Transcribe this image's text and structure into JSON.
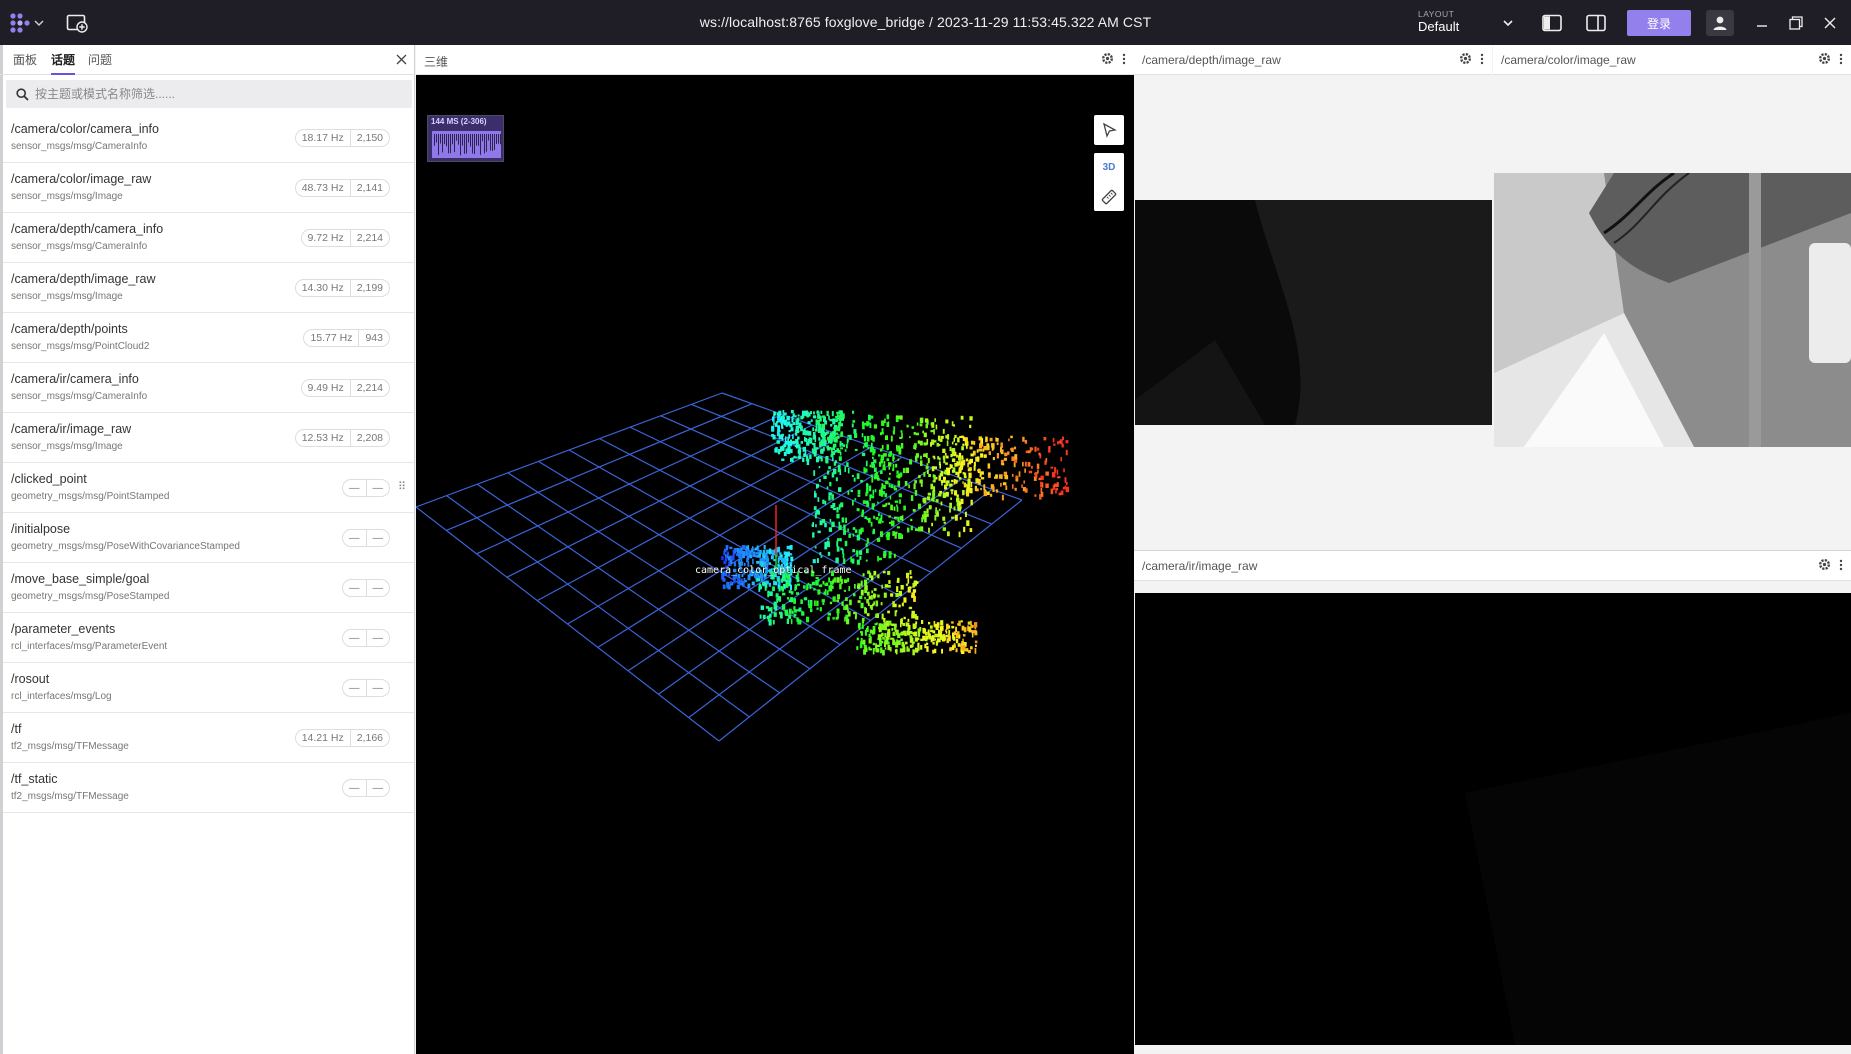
{
  "titlebar": {
    "title": "ws://localhost:8765 foxglove_bridge / 2023-11-29 11:53:45.322 AM CST",
    "layout_label": "LAYOUT",
    "layout_value": "Default",
    "login_label": "登录"
  },
  "sidebar": {
    "tabs": [
      {
        "label": "面板",
        "active": false
      },
      {
        "label": "话题",
        "active": true
      },
      {
        "label": "问题",
        "active": false
      }
    ],
    "search_placeholder": "按主题或模式名称筛选......",
    "topics": [
      {
        "name": "/camera/color/camera_info",
        "type": "sensor_msgs/msg/CameraInfo",
        "hz": "18.17 Hz",
        "count": "2,150"
      },
      {
        "name": "/camera/color/image_raw",
        "type": "sensor_msgs/msg/Image",
        "hz": "48.73 Hz",
        "count": "2,141"
      },
      {
        "name": "/camera/depth/camera_info",
        "type": "sensor_msgs/msg/CameraInfo",
        "hz": "9.72 Hz",
        "count": "2,214"
      },
      {
        "name": "/camera/depth/image_raw",
        "type": "sensor_msgs/msg/Image",
        "hz": "14.30 Hz",
        "count": "2,199"
      },
      {
        "name": "/camera/depth/points",
        "type": "sensor_msgs/msg/PointCloud2",
        "hz": "15.77 Hz",
        "count": "943"
      },
      {
        "name": "/camera/ir/camera_info",
        "type": "sensor_msgs/msg/CameraInfo",
        "hz": "9.49 Hz",
        "count": "2,214"
      },
      {
        "name": "/camera/ir/image_raw",
        "type": "sensor_msgs/msg/Image",
        "hz": "12.53 Hz",
        "count": "2,208"
      },
      {
        "name": "/clicked_point",
        "type": "geometry_msgs/msg/PointStamped",
        "hz": "—",
        "count": "—",
        "drag": "⠿"
      },
      {
        "name": "/initialpose",
        "type": "geometry_msgs/msg/PoseWithCovarianceStamped",
        "hz": "—",
        "count": "—"
      },
      {
        "name": "/move_base_simple/goal",
        "type": "geometry_msgs/msg/PoseStamped",
        "hz": "—",
        "count": "—"
      },
      {
        "name": "/parameter_events",
        "type": "rcl_interfaces/msg/ParameterEvent",
        "hz": "—",
        "count": "—"
      },
      {
        "name": "/rosout",
        "type": "rcl_interfaces/msg/Log",
        "hz": "—",
        "count": "—"
      },
      {
        "name": "/tf",
        "type": "tf2_msgs/msg/TFMessage",
        "hz": "14.21 Hz",
        "count": "2,166"
      },
      {
        "name": "/tf_static",
        "type": "tf2_msgs/msg/TFMessage",
        "hz": "—",
        "count": "—"
      }
    ]
  },
  "panel3d": {
    "title": "三维",
    "perf_label": "144 MS (2-306)",
    "mode_label": "3D",
    "frame_label": "camera_color_optical_frame"
  },
  "panels": {
    "depth_title": "/camera/depth/image_raw",
    "color_title": "/camera/color/image_raw",
    "ir_title": "/camera/ir/image_raw"
  },
  "icons": {
    "logo": "foxglove-logo-icon",
    "add_panel": "add-panel-icon",
    "chevron": "chevron-down-icon",
    "left_sidebar": "left-sidebar-icon",
    "right_sidebar": "right-sidebar-icon",
    "user": "user-icon",
    "minimize": "minimize-icon",
    "maximize": "maximize-icon",
    "close": "close-icon",
    "search": "search-icon",
    "settings": "gear-icon",
    "more": "more-vertical-icon",
    "select": "select-cursor-icon",
    "measure": "ruler-icon"
  },
  "colors": {
    "accent": "#9480ed",
    "titlebar_bg": "#1f1e26",
    "grid": "#3b64d8"
  }
}
